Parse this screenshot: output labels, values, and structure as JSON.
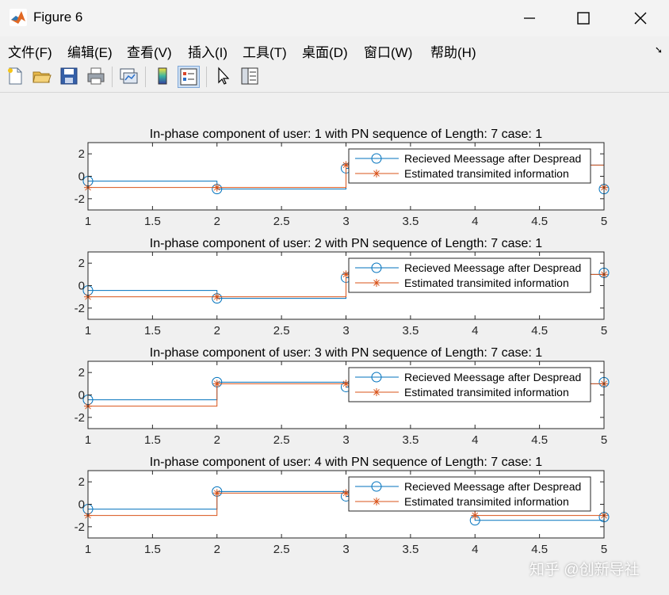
{
  "window": {
    "title": "Figure 6",
    "controls": [
      "minimize",
      "maximize",
      "close"
    ]
  },
  "menu": {
    "items": [
      "文件(F)",
      "编辑(E)",
      "查看(V)",
      "插入(I)",
      "工具(T)",
      "桌面(D)",
      "窗口(W)",
      "帮助(H)"
    ]
  },
  "toolbar": {
    "buttons": [
      "new-figure-icon",
      "open-folder-icon",
      "save-icon",
      "print-icon",
      "link-plot-icon",
      "colorbar-icon",
      "legend-icon",
      "pointer-icon",
      "property-inspector-icon"
    ]
  },
  "colors": {
    "received": "#0072bd",
    "estimated": "#d95319"
  },
  "watermark": "知乎 @创新导社",
  "chart_data": [
    {
      "type": "line",
      "title": "In-phase component of user: 1 with PN sequence of Length: 7 case: 1",
      "x": [
        1,
        2,
        3,
        4,
        5
      ],
      "xticks": [
        "1",
        "1.5",
        "2",
        "2.5",
        "3",
        "3.5",
        "4",
        "4.5",
        "5"
      ],
      "yticks": [
        "2",
        "0",
        "-2"
      ],
      "xlim": [
        1,
        5
      ],
      "ylim": [
        -3,
        3
      ],
      "legend_position": "top-right",
      "series": [
        {
          "name": "Recieved Meessage after Despread",
          "style": "stairs-circle",
          "values": [
            -0.43,
            -1.14,
            0.71,
            1.0,
            -1.14
          ]
        },
        {
          "name": "Estimated transimited information",
          "style": "stairs-star",
          "values": [
            -1,
            -1,
            1,
            1,
            -1
          ]
        }
      ]
    },
    {
      "type": "line",
      "title": "In-phase component of user: 2 with PN sequence of Length: 7 case: 1",
      "x": [
        1,
        2,
        3,
        4,
        5
      ],
      "xticks": [
        "1",
        "1.5",
        "2",
        "2.5",
        "3",
        "3.5",
        "4",
        "4.5",
        "5"
      ],
      "yticks": [
        "2",
        "0",
        "-2"
      ],
      "xlim": [
        1,
        5
      ],
      "ylim": [
        -3,
        3
      ],
      "legend_position": "top-right",
      "series": [
        {
          "name": "Recieved Meessage after Despread",
          "style": "stairs-circle",
          "values": [
            -0.43,
            -1.14,
            0.71,
            1.0,
            1.14
          ]
        },
        {
          "name": "Estimated transimited information",
          "style": "stairs-star",
          "values": [
            -1,
            -1,
            1,
            1,
            1
          ]
        }
      ]
    },
    {
      "type": "line",
      "title": "In-phase component of user: 3 with PN sequence of Length: 7 case: 1",
      "x": [
        1,
        2,
        3,
        4,
        5
      ],
      "xticks": [
        "1",
        "1.5",
        "2",
        "2.5",
        "3",
        "3.5",
        "4",
        "4.5",
        "5"
      ],
      "yticks": [
        "2",
        "0",
        "-2"
      ],
      "xlim": [
        1,
        5
      ],
      "ylim": [
        -3,
        3
      ],
      "legend_position": "top-right",
      "series": [
        {
          "name": "Recieved Meessage after Despread",
          "style": "stairs-circle",
          "values": [
            -0.43,
            1.14,
            0.71,
            1.0,
            1.14
          ]
        },
        {
          "name": "Estimated transimited information",
          "style": "stairs-star",
          "values": [
            -1,
            1,
            1,
            1,
            1
          ]
        }
      ]
    },
    {
      "type": "line",
      "title": "In-phase component of user: 4 with PN sequence of Length: 7 case: 1",
      "x": [
        1,
        2,
        3,
        4,
        5
      ],
      "xticks": [
        "1",
        "1.5",
        "2",
        "2.5",
        "3",
        "3.5",
        "4",
        "4.5",
        "5"
      ],
      "yticks": [
        "2",
        "0",
        "-2"
      ],
      "xlim": [
        1,
        5
      ],
      "ylim": [
        -3,
        3
      ],
      "legend_position": "top-right",
      "series": [
        {
          "name": "Recieved Meessage after Despread",
          "style": "stairs-circle",
          "values": [
            -0.43,
            1.14,
            0.71,
            -1.43,
            -1.14
          ]
        },
        {
          "name": "Estimated transimited information",
          "style": "stairs-star",
          "values": [
            -1,
            1,
            1,
            -1,
            -1
          ]
        }
      ]
    }
  ]
}
